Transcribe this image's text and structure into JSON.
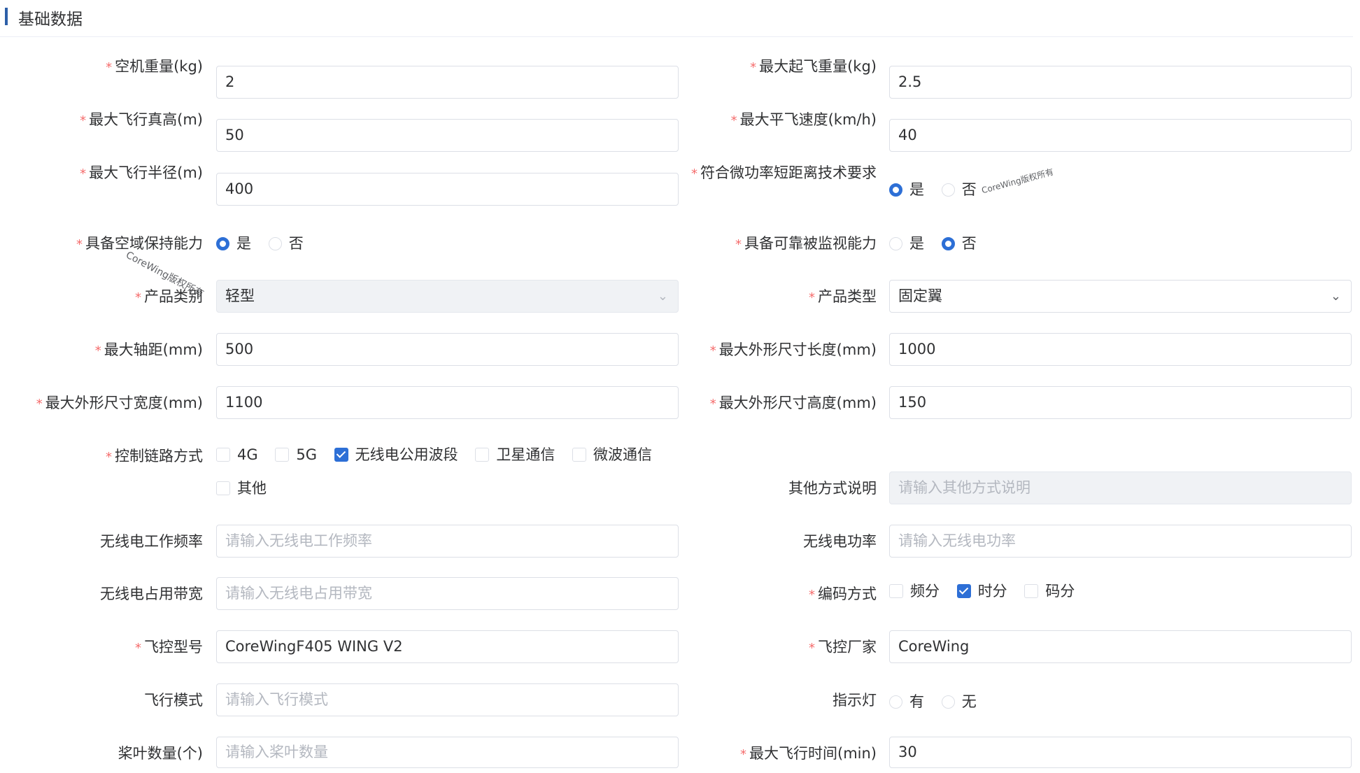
{
  "section": {
    "title": "基础数据"
  },
  "rows": {
    "empty_weight": {
      "label": "空机重量(kg)",
      "value": "2"
    },
    "max_takeoff_weight": {
      "label": "最大起飞重量(kg)",
      "value": "2.5"
    },
    "max_altitude": {
      "label": "最大飞行真高(m)",
      "value": "50"
    },
    "max_speed": {
      "label": "最大平飞速度(km/h)",
      "value": "40"
    },
    "max_radius": {
      "label": "最大飞行半径(m)",
      "value": "400"
    },
    "micro_power": {
      "label": "符合微功率短距离技术要求",
      "yes": "是",
      "no": "否",
      "selected": "是"
    },
    "airspace_keep": {
      "label": "具备空域保持能力",
      "yes": "是",
      "no": "否",
      "selected": "是"
    },
    "monitorable": {
      "label": "具备可靠被监视能力",
      "yes": "是",
      "no": "否",
      "selected": "否"
    },
    "product_category": {
      "label": "产品类别",
      "value": "轻型"
    },
    "product_type": {
      "label": "产品类型",
      "value": "固定翼"
    },
    "max_wheelbase": {
      "label": "最大轴距(mm)",
      "value": "500"
    },
    "max_length": {
      "label": "最大外形尺寸长度(mm)",
      "value": "1000"
    },
    "max_width": {
      "label": "最大外形尺寸宽度(mm)",
      "value": "1100"
    },
    "max_height": {
      "label": "最大外形尺寸高度(mm)",
      "value": "150"
    },
    "control_link": {
      "label": "控制链路方式",
      "options": [
        "4G",
        "5G",
        "无线电公用波段",
        "卫星通信",
        "微波通信",
        "其他"
      ],
      "checked": [
        "无线电公用波段"
      ]
    },
    "other_desc": {
      "label": "其他方式说明",
      "placeholder": "请输入其他方式说明"
    },
    "radio_freq": {
      "label": "无线电工作频率",
      "placeholder": "请输入无线电工作频率"
    },
    "radio_power": {
      "label": "无线电功率",
      "placeholder": "请输入无线电功率"
    },
    "radio_bandwidth": {
      "label": "无线电占用带宽",
      "placeholder": "请输入无线电占用带宽"
    },
    "encoding": {
      "label": "编码方式",
      "options": [
        "频分",
        "时分",
        "码分"
      ],
      "checked": [
        "时分"
      ]
    },
    "fc_model": {
      "label": "飞控型号",
      "value": "CoreWingF405 WING V2"
    },
    "fc_vendor": {
      "label": "飞控厂家",
      "value": "CoreWing"
    },
    "flight_mode": {
      "label": "飞行模式",
      "placeholder": "请输入飞行模式"
    },
    "indicator": {
      "label": "指示灯",
      "yes": "有",
      "no": "无",
      "selected": ""
    },
    "blade_count": {
      "label": "桨叶数量(个)",
      "placeholder": "请输入桨叶数量"
    },
    "max_flight_time": {
      "label": "最大飞行时间(min)",
      "value": "30"
    }
  },
  "watermarks": [
    "CoreWing版权所有",
    "CoreWing版权所有"
  ],
  "colors": {
    "accent": "#2d6fd6",
    "required": "#f56c6c",
    "header_bar": "#2d5fa8"
  }
}
